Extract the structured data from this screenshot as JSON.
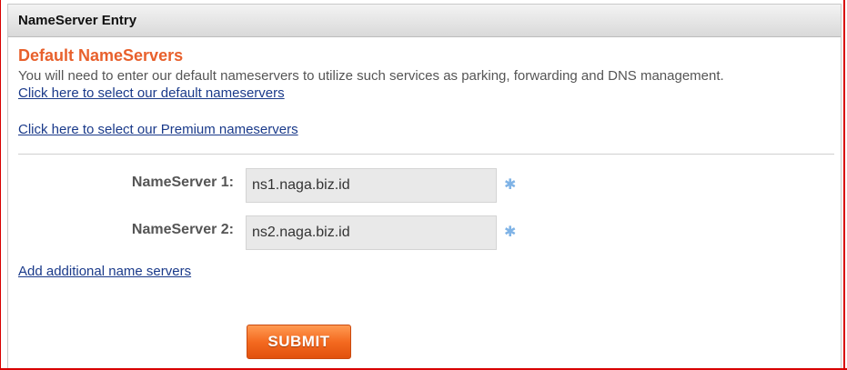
{
  "panel": {
    "title": "NameServer Entry"
  },
  "section": {
    "title": "Default NameServers",
    "description": "You will need to enter our default nameservers to utilize such services as parking, forwarding and DNS management.",
    "default_link": "Click here to select our default nameservers",
    "premium_link": "Click here to select our Premium nameservers"
  },
  "nameservers": [
    {
      "label": "NameServer 1:",
      "value": "ns1.naga.biz.id",
      "required_mark": "✱"
    },
    {
      "label": "NameServer 2:",
      "value": "ns2.naga.biz.id",
      "required_mark": "✱"
    }
  ],
  "add_link": "Add additional name servers",
  "submit_label": "SUBMIT",
  "colors": {
    "accent": "#e8602c",
    "link": "#1a3a8a",
    "required": "#7fb3e6"
  }
}
